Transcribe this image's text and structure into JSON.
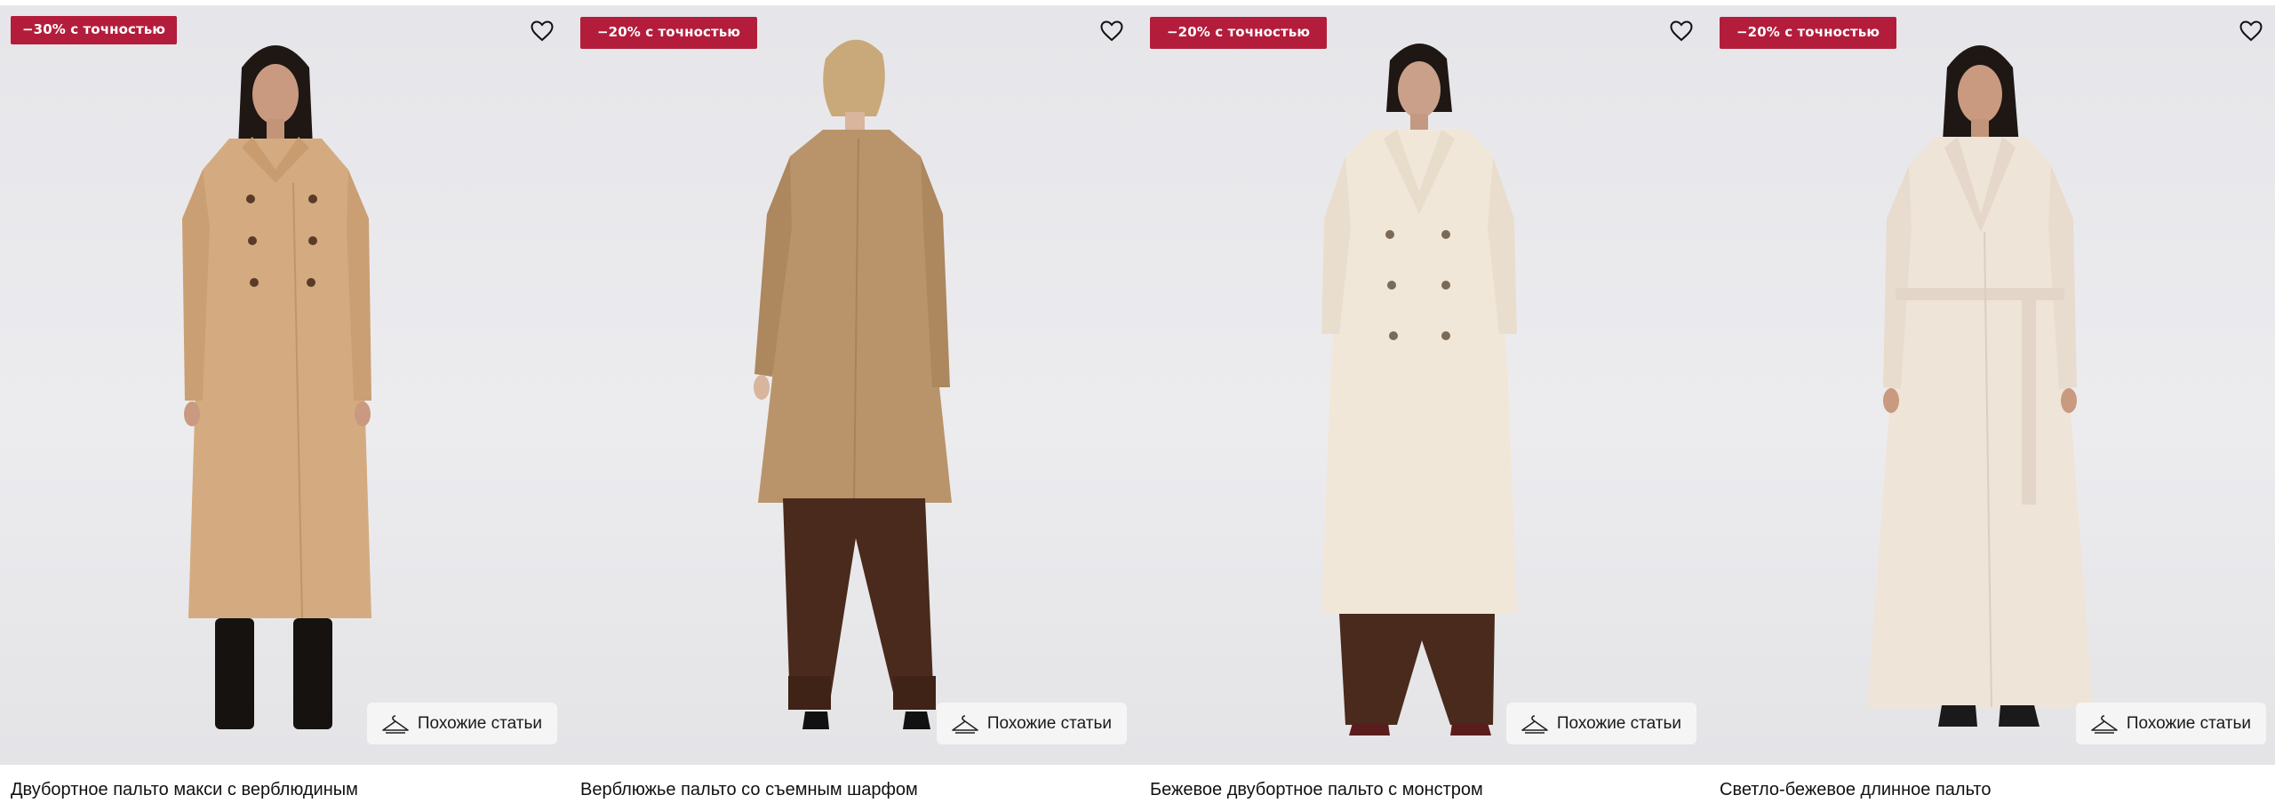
{
  "products": [
    {
      "badge": "−30% с точностью",
      "title": "Двубортное пальто макси с верблюдиным",
      "similar_label": "Похожие статьи",
      "coat_color": "#d4ab80",
      "trousers_color": "none"
    },
    {
      "badge": "−20% с точностью",
      "title": "Верблюжье пальто со съемным шарфом",
      "similar_label": "Похожие статьи",
      "coat_color": "#b9946a",
      "trousers_color": "#4a2a1c"
    },
    {
      "badge": "−20% с точностью",
      "title": "Бежевое двубортное пальто с монстром",
      "similar_label": "Похожие статьи",
      "coat_color": "#f1e7d8",
      "trousers_color": "#4a2a1c"
    },
    {
      "badge": "−20% с точностью",
      "title": "Светло-бежевое длинное пальто",
      "similar_label": "Похожие статьи",
      "coat_color": "#efe4d8",
      "trousers_color": "none"
    }
  ],
  "icons": {
    "favorite": "heart-icon",
    "similar": "hanger-icon"
  },
  "colors": {
    "badge_bg": "#b31d3b",
    "badge_text": "#ffffff"
  }
}
